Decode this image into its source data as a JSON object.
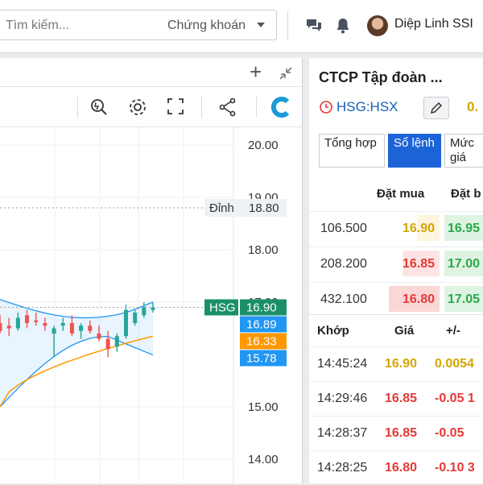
{
  "topbar": {
    "search_placeholder": "Tìm kiếm...",
    "search_filter": "Chứng khoán",
    "user_name": "Diệp Linh SSI"
  },
  "toolbar": {
    "add_label": "+"
  },
  "chart": {
    "price_axis": [
      "20.00",
      "19.00",
      "18.00",
      "17.00",
      "15.00",
      "14.00"
    ],
    "peak_label": "Đỉnh",
    "peak_value": "18.80",
    "symbol_badge": "HSG",
    "last_price": "16.90",
    "band_upper": "16.89",
    "band_mid": "16.33",
    "band_lower": "15.78",
    "colors": {
      "up": "#26a69a",
      "down": "#ef5350",
      "band": "#2196f3",
      "ma": "#ff9800"
    }
  },
  "chart_data": {
    "type": "candlestick",
    "title": "",
    "price_levels": {
      "peak": 18.8,
      "last": 16.9,
      "bb_upper": 16.89,
      "bb_mid": 16.33,
      "bb_lower": 15.78
    },
    "y_ticks": [
      20.0,
      19.0,
      18.0,
      17.0,
      15.0,
      14.0
    ],
    "ylim": [
      13.6,
      20.4
    ],
    "candles": [
      {
        "o": 16.6,
        "h": 16.75,
        "l": 16.4,
        "c": 16.45
      },
      {
        "o": 16.55,
        "h": 16.7,
        "l": 16.35,
        "c": 16.5
      },
      {
        "o": 16.5,
        "h": 16.8,
        "l": 16.45,
        "c": 16.7
      },
      {
        "o": 16.75,
        "h": 16.85,
        "l": 16.5,
        "c": 16.6
      },
      {
        "o": 16.65,
        "h": 16.8,
        "l": 16.55,
        "c": 16.62
      },
      {
        "o": 16.6,
        "h": 16.7,
        "l": 16.45,
        "c": 16.55
      },
      {
        "o": 16.4,
        "h": 16.55,
        "l": 15.95,
        "c": 16.5
      },
      {
        "o": 16.55,
        "h": 16.7,
        "l": 16.45,
        "c": 16.6
      },
      {
        "o": 16.6,
        "h": 16.75,
        "l": 16.35,
        "c": 16.4
      },
      {
        "o": 16.45,
        "h": 16.6,
        "l": 16.3,
        "c": 16.55
      },
      {
        "o": 16.55,
        "h": 16.65,
        "l": 16.4,
        "c": 16.45
      },
      {
        "o": 16.4,
        "h": 16.55,
        "l": 16.25,
        "c": 16.3
      },
      {
        "o": 16.3,
        "h": 16.45,
        "l": 15.95,
        "c": 16.1
      },
      {
        "o": 16.15,
        "h": 16.4,
        "l": 16.05,
        "c": 16.35
      },
      {
        "o": 16.35,
        "h": 16.95,
        "l": 16.3,
        "c": 16.85
      },
      {
        "o": 16.6,
        "h": 16.85,
        "l": 16.55,
        "c": 16.8
      },
      {
        "o": 16.75,
        "h": 17.0,
        "l": 16.7,
        "c": 16.9
      },
      {
        "o": 16.85,
        "h": 17.0,
        "l": 16.8,
        "c": 16.9
      }
    ]
  },
  "right": {
    "company": "CTCP Tập đoàn ...",
    "ticker": "HSG:HSX",
    "price_peek": "0.",
    "tabs": [
      "Tổng hợp",
      "Sổ lệnh",
      "Mức giá"
    ],
    "ob_headers": {
      "bid": "Đặt mua",
      "ask": "Đặt b"
    },
    "orderbook": [
      {
        "vol": "106.500",
        "bid": "16.90",
        "ask": "16.95"
      },
      {
        "vol": "208.200",
        "bid": "16.85",
        "ask": "17.00"
      },
      {
        "vol": "432.100",
        "bid": "16.80",
        "ask": "17.05"
      }
    ],
    "mt_headers": {
      "time": "Khớp",
      "price": "Giá",
      "chg": "+/-"
    },
    "matched": [
      {
        "time": "14:45:24",
        "price": "16.90",
        "chg": "0.0054"
      },
      {
        "time": "14:29:46",
        "price": "16.85",
        "chg": "-0.05 1"
      },
      {
        "time": "14:28:37",
        "price": "16.85",
        "chg": "-0.05"
      },
      {
        "time": "14:28:25",
        "price": "16.80",
        "chg": "-0.10 3"
      }
    ],
    "colors": {
      "ref": "#d4a600",
      "down": "#e53935",
      "up": "#2aa84a"
    }
  }
}
